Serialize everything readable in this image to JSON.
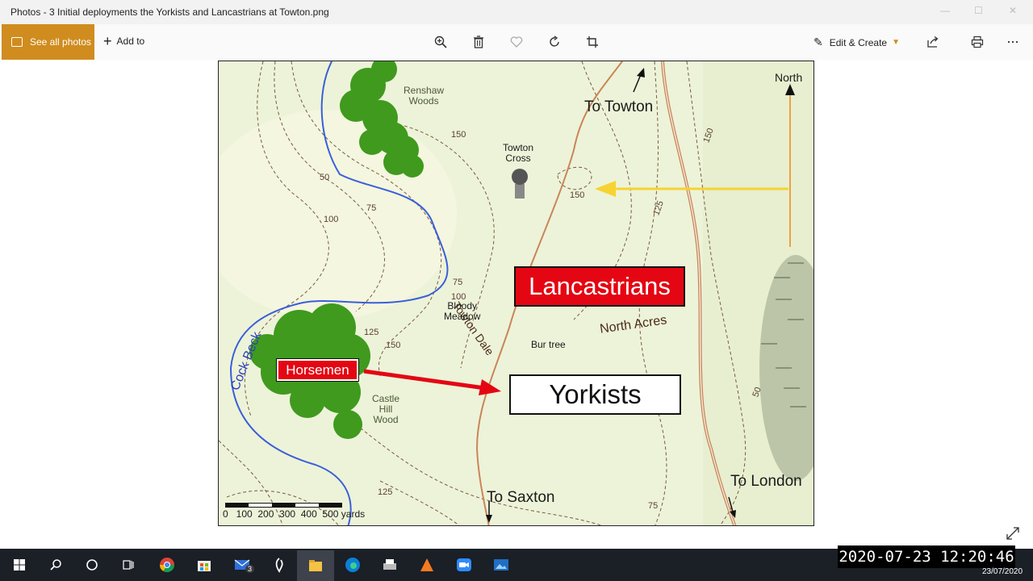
{
  "window": {
    "title": "Photos - 3 Initial deployments the Yorkists and Lancastrians at Towton.png",
    "controls": [
      "minimize-icon",
      "maximize-icon",
      "close-icon"
    ]
  },
  "toolbar": {
    "see_all_label": "See all photos",
    "add_to_label": "Add to",
    "edit_create_label": "Edit & Create",
    "icons": [
      "zoom-icon",
      "delete-icon",
      "favorite-icon",
      "rotate-icon",
      "crop-icon",
      "share-icon",
      "print-icon",
      "more-icon"
    ],
    "accent": "#d08c1e"
  },
  "map": {
    "labels": {
      "renshaw": [
        "Renshaw",
        "Woods"
      ],
      "towton_cross": [
        "Towton",
        "Cross"
      ],
      "to_towton": "To Towton",
      "north": "North",
      "towton_dale": "Towton Dale",
      "bloody_meadow": [
        "Bloody",
        "Meadow"
      ],
      "north_acres": "North Acres",
      "bur_tree": "Bur tree",
      "cock_beck": "Cock Beck",
      "castle_hill": [
        "Castle",
        "Hill",
        "Wood"
      ],
      "to_saxton": "To Saxton",
      "to_london": "To London",
      "scale": "0   100  200  300  400  500 yards"
    },
    "contour_values": [
      "150",
      "50",
      "100",
      "75",
      "150",
      "75",
      "100",
      "125",
      "150",
      "125",
      "150",
      "125",
      "75",
      "50",
      "125",
      "100"
    ],
    "lancastrians": "Lancastrians",
    "yorkists": "Yorkists",
    "horsemen": "Horsemen",
    "colors": {
      "lancastrian_box": "#e40613",
      "yorkist_box": "#ffffff",
      "river": "#3a5fd9",
      "road": "#c9855a",
      "woods": "#3f9a1e",
      "map_bg": "#edf3d8",
      "north_arrow": "#f0a040",
      "pointer_arrow": "#f6d330"
    }
  },
  "taskbar": {
    "icons": [
      "windows-start-icon",
      "search-icon",
      "cortana-icon",
      "task-view-icon",
      "chrome-icon",
      "store-icon",
      "mail-icon",
      "app-icon",
      "file-explorer-icon",
      "edge-icon",
      "printer-app-icon",
      "vlc-icon",
      "zoom-app-icon",
      "photos-app-icon"
    ],
    "mail_badge": "3",
    "clock_date": "23/07/2020"
  },
  "overlay_timestamp": "2020-07-23 12:20:46"
}
